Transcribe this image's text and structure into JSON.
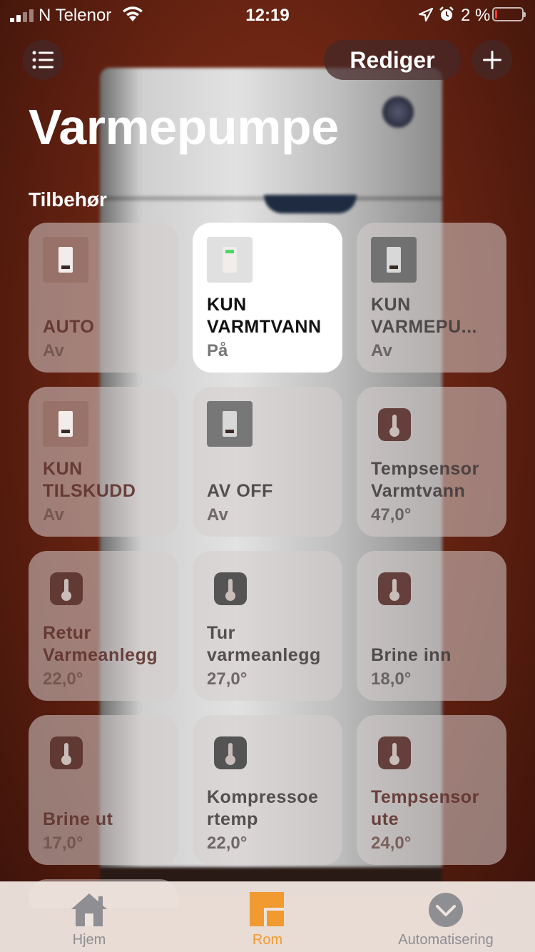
{
  "status_bar": {
    "carrier": "N Telenor",
    "time": "12:19",
    "battery_percent": "2 %",
    "battery_level": 0.02,
    "signal_bars": 2
  },
  "header": {
    "edit_label": "Rediger",
    "title": "Varmepumpe",
    "section_label": "Tilbehør"
  },
  "tiles": [
    {
      "name": "AUTO",
      "state": "Av"
    },
    {
      "name": "KUN VARMTVANN",
      "state": "På"
    },
    {
      "name": "KUN VARMEPU...",
      "state": "Av"
    },
    {
      "name": "KUN TILSKUDD",
      "state": "Av"
    },
    {
      "name": "AV OFF",
      "state": "Av"
    },
    {
      "name": "Tempsensor Varmtvann",
      "state": "47,0°"
    },
    {
      "name": "Retur Varmeanlegg",
      "state": "22,0°"
    },
    {
      "name": "Tur varmeanlegg",
      "state": "27,0°"
    },
    {
      "name": "Brine inn",
      "state": "18,0°"
    },
    {
      "name": "Brine ut",
      "state": "17,0°"
    },
    {
      "name": "Kompressoe rtemp",
      "state": "22,0°"
    },
    {
      "name": "Tempsensor ute",
      "state": "24,0°"
    }
  ],
  "tab_bar": {
    "home": "Hjem",
    "rooms": "Rom",
    "automation": "Automatisering",
    "active_color": "#f09a30",
    "inactive_color": "#8e8e93"
  }
}
